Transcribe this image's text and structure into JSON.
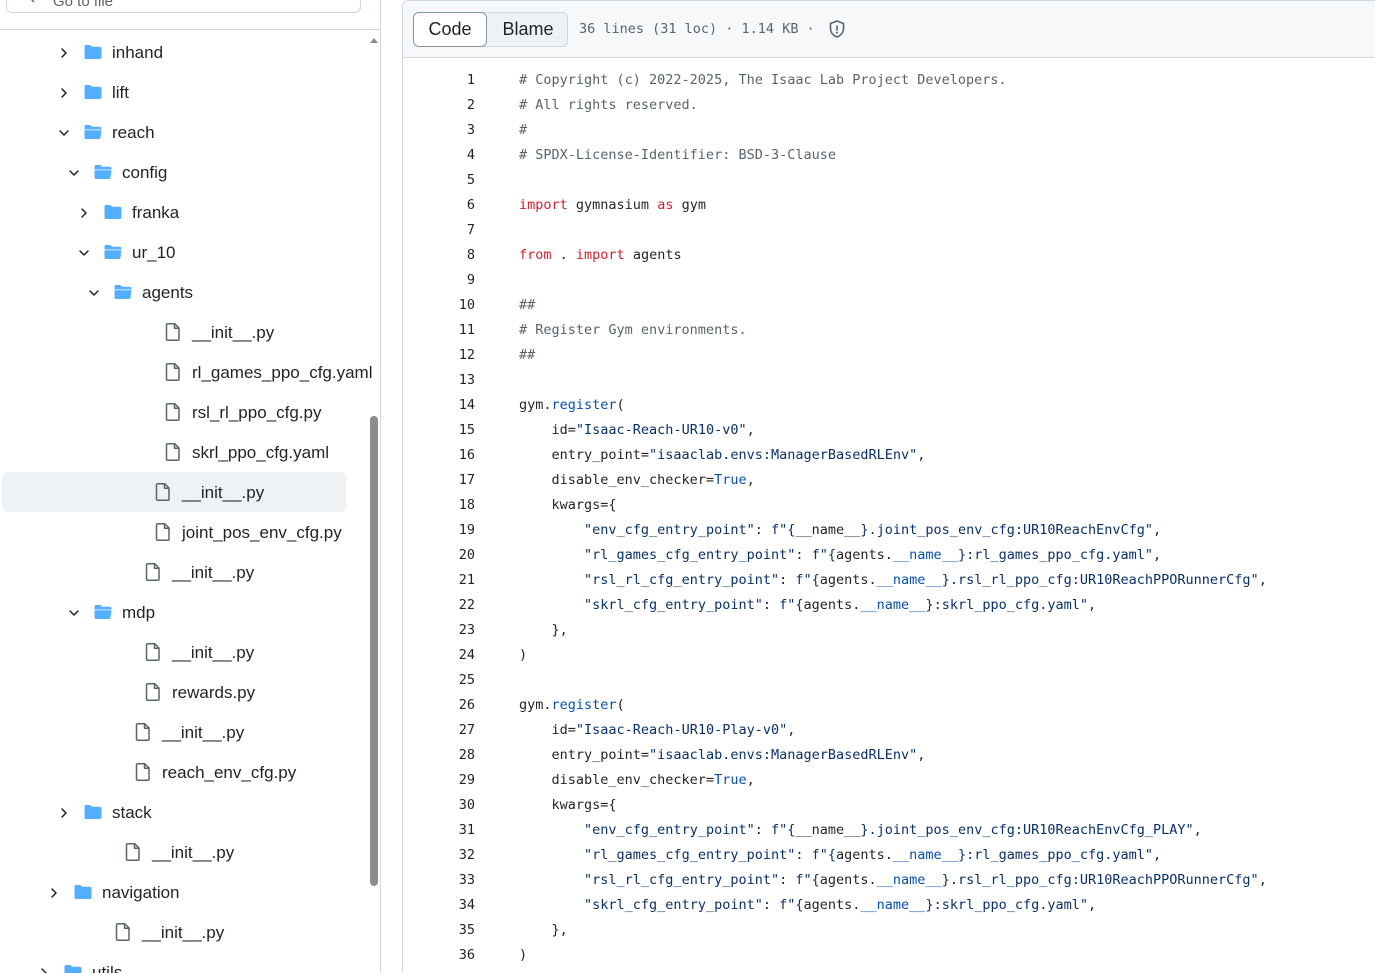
{
  "search": {
    "placeholder": "Go to file"
  },
  "tree": [
    {
      "label": "inhand",
      "type": "folder",
      "depth": 0,
      "expanded": false
    },
    {
      "label": "lift",
      "type": "folder",
      "depth": 0,
      "expanded": false
    },
    {
      "label": "reach",
      "type": "folder",
      "depth": 0,
      "expanded": true
    },
    {
      "label": "config",
      "type": "folder",
      "depth": 1,
      "expanded": true
    },
    {
      "label": "franka",
      "type": "folder",
      "depth": 2,
      "expanded": false
    },
    {
      "label": "ur_10",
      "type": "folder",
      "depth": 2,
      "expanded": true
    },
    {
      "label": "agents",
      "type": "folder",
      "depth": 3,
      "expanded": true
    },
    {
      "label": "__init__.py",
      "type": "file",
      "depth": 4
    },
    {
      "label": "rl_games_ppo_cfg.yaml",
      "type": "file",
      "depth": 4
    },
    {
      "label": "rsl_rl_ppo_cfg.py",
      "type": "file",
      "depth": 4
    },
    {
      "label": "skrl_ppo_cfg.yaml",
      "type": "file",
      "depth": 4
    },
    {
      "label": "__init__.py",
      "type": "file",
      "depth": 3,
      "selected": true
    },
    {
      "label": "joint_pos_env_cfg.py",
      "type": "file",
      "depth": 3
    },
    {
      "label": "__init__.py",
      "type": "file",
      "depth": 2
    },
    {
      "label": "mdp",
      "type": "folder",
      "depth": 1,
      "expanded": true
    },
    {
      "label": "__init__.py",
      "type": "file",
      "depth": 2
    },
    {
      "label": "rewards.py",
      "type": "file",
      "depth": 2
    },
    {
      "label": "__init__.py",
      "type": "file",
      "depth": 1
    },
    {
      "label": "reach_env_cfg.py",
      "type": "file",
      "depth": 1
    },
    {
      "label": "stack",
      "type": "folder",
      "depth": 0,
      "expanded": false
    },
    {
      "label": "__init__.py",
      "type": "file",
      "depth": 0
    },
    {
      "label": "navigation",
      "type": "folder",
      "depth": -1,
      "expanded": false
    },
    {
      "label": "__init__.py",
      "type": "file",
      "depth": -1
    },
    {
      "label": "utils",
      "type": "folder",
      "depth": -2,
      "expanded": false
    }
  ],
  "file_header": {
    "code_tab": "Code",
    "blame_tab": "Blame",
    "stats": "36 lines (31 loc) · 1.14 KB ·"
  },
  "icons": {
    "folder_color": "#54aeff",
    "file_color": "#59636e",
    "chevron": "chevron-icon",
    "shield": "shield-icon"
  },
  "colors": {
    "keyword": "#cf222e",
    "string": "#0a3069",
    "function": "#0550ae",
    "comment": "#59636e"
  },
  "code_lines": [
    [
      [
        "c",
        "# Copyright (c) 2022-2025, The Isaac Lab Project Developers."
      ]
    ],
    [
      [
        "c",
        "# All rights reserved."
      ]
    ],
    [
      [
        "c",
        "#"
      ]
    ],
    [
      [
        "c",
        "# SPDX-License-Identifier: BSD-3-Clause"
      ]
    ],
    [],
    [
      [
        "k",
        "import"
      ],
      [
        "p",
        " gymnasium "
      ],
      [
        "k",
        "as"
      ],
      [
        "p",
        " gym"
      ]
    ],
    [],
    [
      [
        "k",
        "from"
      ],
      [
        "p",
        " . "
      ],
      [
        "k",
        "import"
      ],
      [
        "p",
        " agents"
      ]
    ],
    [],
    [
      [
        "c",
        "##"
      ]
    ],
    [
      [
        "c",
        "# Register Gym environments."
      ]
    ],
    [
      [
        "c",
        "##"
      ]
    ],
    [],
    [
      [
        "p",
        "gym."
      ],
      [
        "f",
        "register"
      ],
      [
        "p",
        "("
      ]
    ],
    [
      [
        "p",
        "    id="
      ],
      [
        "s",
        "\"Isaac-Reach-UR10-v0\""
      ],
      [
        "p",
        ","
      ]
    ],
    [
      [
        "p",
        "    entry_point="
      ],
      [
        "s",
        "\"isaaclab.envs:ManagerBasedRLEnv\""
      ],
      [
        "p",
        ","
      ]
    ],
    [
      [
        "p",
        "    disable_env_checker="
      ],
      [
        "n",
        "True"
      ],
      [
        "p",
        ","
      ]
    ],
    [
      [
        "p",
        "    kwargs={"
      ]
    ],
    [
      [
        "p",
        "        "
      ],
      [
        "s",
        "\"env_cfg_entry_point\""
      ],
      [
        "p",
        ": "
      ],
      [
        "s",
        "f\"{"
      ],
      [
        "p",
        "__name__"
      ],
      [
        "s",
        "}.joint_pos_env_cfg:UR10ReachEnvCfg\""
      ],
      [
        "p",
        ","
      ]
    ],
    [
      [
        "p",
        "        "
      ],
      [
        "s",
        "\"rl_games_cfg_entry_point\""
      ],
      [
        "p",
        ": "
      ],
      [
        "s",
        "f\"{"
      ],
      [
        "p",
        "agents."
      ],
      [
        "n",
        "__name__"
      ],
      [
        "s",
        "}:rl_games_ppo_cfg.yaml\""
      ],
      [
        "p",
        ","
      ]
    ],
    [
      [
        "p",
        "        "
      ],
      [
        "s",
        "\"rsl_rl_cfg_entry_point\""
      ],
      [
        "p",
        ": "
      ],
      [
        "s",
        "f\"{"
      ],
      [
        "p",
        "agents."
      ],
      [
        "n",
        "__name__"
      ],
      [
        "s",
        "}.rsl_rl_ppo_cfg:UR10ReachPPORunnerCfg\""
      ],
      [
        "p",
        ","
      ]
    ],
    [
      [
        "p",
        "        "
      ],
      [
        "s",
        "\"skrl_cfg_entry_point\""
      ],
      [
        "p",
        ": "
      ],
      [
        "s",
        "f\"{"
      ],
      [
        "p",
        "agents."
      ],
      [
        "n",
        "__name__"
      ],
      [
        "s",
        "}:skrl_ppo_cfg.yaml\""
      ],
      [
        "p",
        ","
      ]
    ],
    [
      [
        "p",
        "    },"
      ]
    ],
    [
      [
        "p",
        ")"
      ]
    ],
    [],
    [
      [
        "p",
        "gym."
      ],
      [
        "f",
        "register"
      ],
      [
        "p",
        "("
      ]
    ],
    [
      [
        "p",
        "    id="
      ],
      [
        "s",
        "\"Isaac-Reach-UR10-Play-v0\""
      ],
      [
        "p",
        ","
      ]
    ],
    [
      [
        "p",
        "    entry_point="
      ],
      [
        "s",
        "\"isaaclab.envs:ManagerBasedRLEnv\""
      ],
      [
        "p",
        ","
      ]
    ],
    [
      [
        "p",
        "    disable_env_checker="
      ],
      [
        "n",
        "True"
      ],
      [
        "p",
        ","
      ]
    ],
    [
      [
        "p",
        "    kwargs={"
      ]
    ],
    [
      [
        "p",
        "        "
      ],
      [
        "s",
        "\"env_cfg_entry_point\""
      ],
      [
        "p",
        ": "
      ],
      [
        "s",
        "f\"{"
      ],
      [
        "p",
        "__name__"
      ],
      [
        "s",
        "}.joint_pos_env_cfg:UR10ReachEnvCfg_PLAY\""
      ],
      [
        "p",
        ","
      ]
    ],
    [
      [
        "p",
        "        "
      ],
      [
        "s",
        "\"rl_games_cfg_entry_point\""
      ],
      [
        "p",
        ": "
      ],
      [
        "s",
        "f\"{"
      ],
      [
        "p",
        "agents."
      ],
      [
        "n",
        "__name__"
      ],
      [
        "s",
        "}:rl_games_ppo_cfg.yaml\""
      ],
      [
        "p",
        ","
      ]
    ],
    [
      [
        "p",
        "        "
      ],
      [
        "s",
        "\"rsl_rl_cfg_entry_point\""
      ],
      [
        "p",
        ": "
      ],
      [
        "s",
        "f\"{"
      ],
      [
        "p",
        "agents."
      ],
      [
        "n",
        "__name__"
      ],
      [
        "s",
        "}.rsl_rl_ppo_cfg:UR10ReachPPORunnerCfg\""
      ],
      [
        "p",
        ","
      ]
    ],
    [
      [
        "p",
        "        "
      ],
      [
        "s",
        "\"skrl_cfg_entry_point\""
      ],
      [
        "p",
        ": "
      ],
      [
        "s",
        "f\"{"
      ],
      [
        "p",
        "agents."
      ],
      [
        "n",
        "__name__"
      ],
      [
        "s",
        "}:skrl_ppo_cfg.yaml\""
      ],
      [
        "p",
        ","
      ]
    ],
    [
      [
        "p",
        "    },"
      ]
    ],
    [
      [
        "p",
        ")"
      ]
    ]
  ]
}
